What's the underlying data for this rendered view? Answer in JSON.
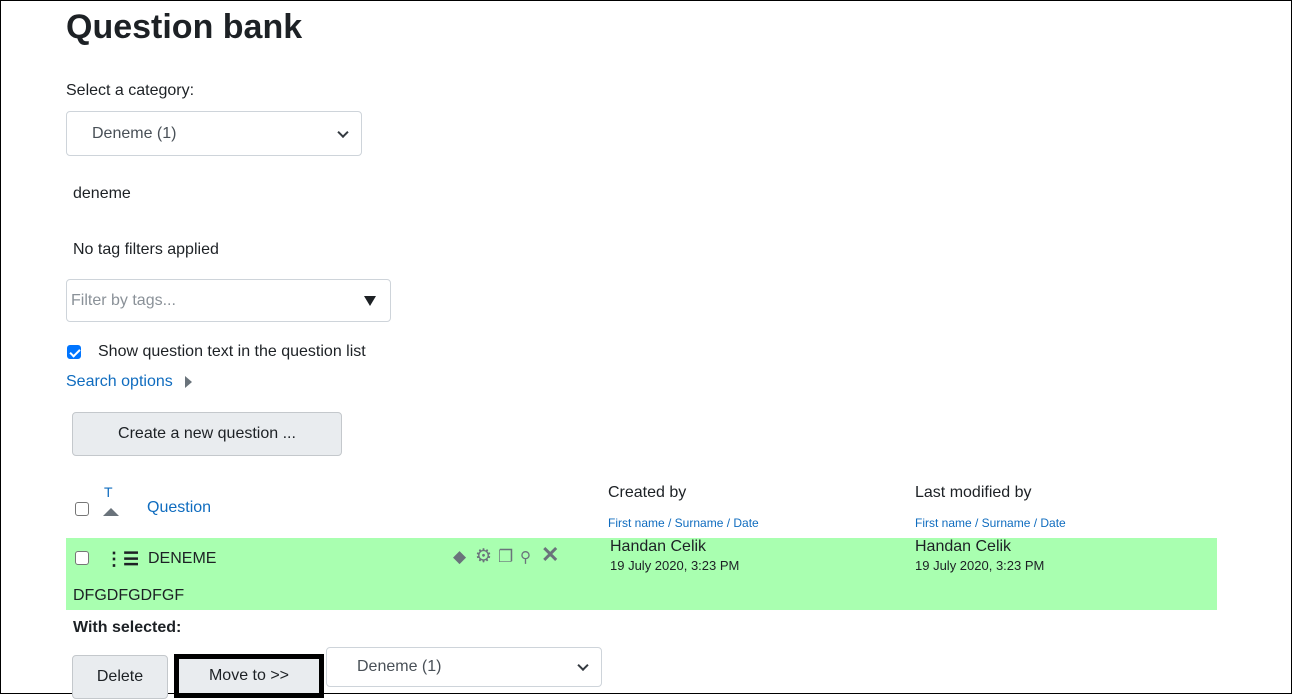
{
  "page": {
    "title": "Question bank"
  },
  "category": {
    "label": "Select a category:",
    "selected": "Deneme (1)",
    "description": "deneme"
  },
  "tags": {
    "status": "No tag filters applied",
    "placeholder": "Filter by tags..."
  },
  "options": {
    "show_text_label": "Show question text in the question list",
    "show_text_checked": true,
    "search_options": "Search options"
  },
  "actions": {
    "create_new": "Create a new question ..."
  },
  "table": {
    "sort_type_label": "T",
    "question_header": "Question",
    "created_header": "Created by",
    "created_sub": "First name / Surname / Date",
    "modified_header": "Last modified by",
    "modified_sub": "First name / Surname / Date",
    "rows": [
      {
        "name": "DENEME",
        "text": "DFGDFGDFGF",
        "created_name": "Handan Celik",
        "created_date": "19 July 2020, 3:23 PM",
        "modified_name": "Handan Celik",
        "modified_date": "19 July 2020, 3:23 PM",
        "icons": [
          "tag-icon",
          "gear-icon",
          "duplicate-icon",
          "preview-icon",
          "delete-icon"
        ]
      }
    ]
  },
  "bulk": {
    "label": "With selected:",
    "delete": "Delete",
    "move": "Move to >>",
    "target": "Deneme (1)"
  },
  "colors": {
    "row_highlight": "#a9ffb0",
    "link": "#0f6cbf",
    "checkbox": "#0075ff"
  }
}
